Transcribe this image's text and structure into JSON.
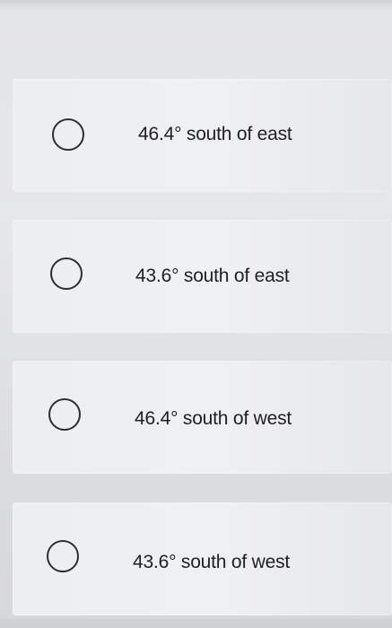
{
  "question": {
    "options": [
      {
        "label": "46.4° south of east",
        "selected": false
      },
      {
        "label": "43.6° south of east",
        "selected": false
      },
      {
        "label": "46.4° south of west",
        "selected": false
      },
      {
        "label": "43.6° south of west",
        "selected": false
      }
    ]
  }
}
